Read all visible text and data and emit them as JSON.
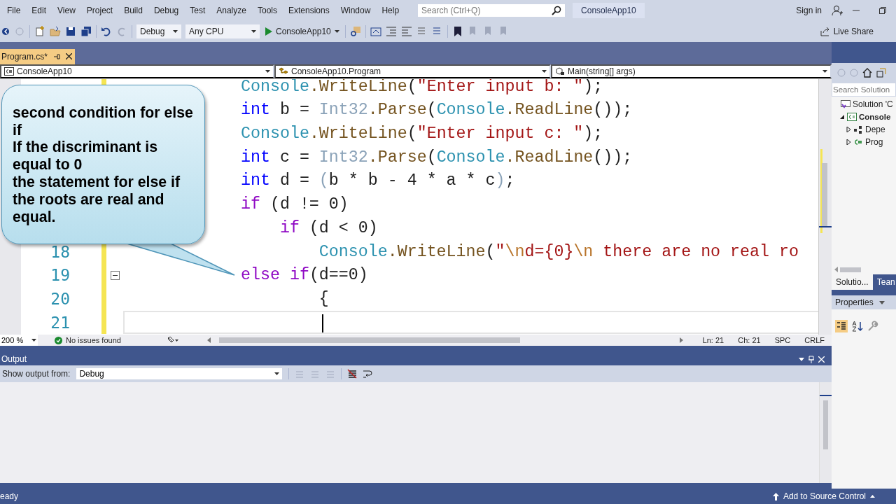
{
  "menu": [
    "File",
    "Edit",
    "View",
    "Project",
    "Build",
    "Debug",
    "Test",
    "Analyze",
    "Tools",
    "Extensions",
    "Window",
    "Help"
  ],
  "search": {
    "placeholder": "Search (Ctrl+Q)"
  },
  "solution_badge": "ConsoleApp10",
  "account": {
    "sign_in": "Sign in"
  },
  "toolbar": {
    "configuration": "Debug",
    "platform": "Any CPU",
    "start": "ConsoleApp10",
    "live_share": "Live Share"
  },
  "document_tabs": [
    {
      "label": "Program.cs*",
      "selected": true
    }
  ],
  "navigation": {
    "project": "ConsoleApp10",
    "type": "ConsoleApp10.Program",
    "member": "Main(string[] args)"
  },
  "editor": {
    "lines": [
      {
        "tokens": [
          {
            "kind": "type",
            "text": "Console"
          },
          {
            "kind": "method",
            "text": ".WriteLine"
          },
          {
            "kind": "plain",
            "text": "("
          },
          {
            "kind": "string",
            "text": "\"Enter input b: \""
          },
          {
            "kind": "plain",
            "text": ");"
          }
        ]
      },
      {
        "tokens": [
          {
            "kind": "keyword",
            "text": "int"
          },
          {
            "kind": "plain",
            "text": " b = "
          },
          {
            "kind": "faded",
            "text": "Int32"
          },
          {
            "kind": "method",
            "text": ".Parse"
          },
          {
            "kind": "plain",
            "text": "("
          },
          {
            "kind": "type",
            "text": "Console"
          },
          {
            "kind": "method",
            "text": ".ReadLine"
          },
          {
            "kind": "plain",
            "text": "());"
          }
        ]
      },
      {
        "tokens": [
          {
            "kind": "type",
            "text": "Console"
          },
          {
            "kind": "method",
            "text": ".WriteLine"
          },
          {
            "kind": "plain",
            "text": "("
          },
          {
            "kind": "string",
            "text": "\"Enter input c: \""
          },
          {
            "kind": "plain",
            "text": ");"
          }
        ]
      },
      {
        "tokens": [
          {
            "kind": "keyword",
            "text": "int"
          },
          {
            "kind": "plain",
            "text": " c = "
          },
          {
            "kind": "faded",
            "text": "Int32"
          },
          {
            "kind": "method",
            "text": ".Parse"
          },
          {
            "kind": "plain",
            "text": "("
          },
          {
            "kind": "type",
            "text": "Console"
          },
          {
            "kind": "method",
            "text": ".ReadLine"
          },
          {
            "kind": "plain",
            "text": "());"
          }
        ]
      },
      {
        "tokens": [
          {
            "kind": "keyword",
            "text": "int"
          },
          {
            "kind": "plain",
            "text": " d = "
          },
          {
            "kind": "faded",
            "text": "("
          },
          {
            "kind": "plain",
            "text": "b * b - 4 * a * c"
          },
          {
            "kind": "faded",
            "text": ")"
          },
          {
            "kind": "plain",
            "text": ";"
          }
        ]
      },
      {
        "tokens": [
          {
            "kind": "control",
            "text": "if"
          },
          {
            "kind": "plain",
            "text": " (d != 0)"
          }
        ]
      },
      {
        "tokens": [
          {
            "kind": "control",
            "text": "    if"
          },
          {
            "kind": "plain",
            "text": " (d < 0)"
          }
        ]
      },
      {
        "number": "18",
        "tokens": [
          {
            "kind": "type",
            "text": "        Console"
          },
          {
            "kind": "method",
            "text": ".WriteLine"
          },
          {
            "kind": "plain",
            "text": "("
          },
          {
            "kind": "string",
            "text": "\""
          },
          {
            "kind": "escape",
            "text": "\\n"
          },
          {
            "kind": "string",
            "text": "d={0}"
          },
          {
            "kind": "escape",
            "text": "\\n"
          },
          {
            "kind": "string",
            "text": " there are no real ro"
          }
        ]
      },
      {
        "number": "19",
        "collapsible": true,
        "tokens": [
          {
            "kind": "control",
            "text": "else if"
          },
          {
            "kind": "plain",
            "text": "(d==0)"
          }
        ]
      },
      {
        "number": "20",
        "tokens": [
          {
            "kind": "plain",
            "text": "        {"
          }
        ]
      },
      {
        "number": "21",
        "current": true
      }
    ],
    "callout": "second condition for else if\nIf the discriminant is equal to 0\nthe statement for else if the roots are real and equal."
  },
  "editor_status": {
    "zoom": "200 %",
    "issues": "No issues found",
    "line": "Ln: 21",
    "column": "Ch: 21",
    "whitespace": "SPC",
    "line_ending": "CRLF"
  },
  "output": {
    "title": "Output",
    "source_label": "Show output from:",
    "source": "Debug"
  },
  "solution_explorer": {
    "search_placeholder": "Search Solution",
    "tree": [
      {
        "label": "Solution 'C",
        "kind": "solution",
        "children": [
          {
            "label": "Console",
            "kind": "project",
            "expanded": true,
            "children": [
              {
                "label": "Depe",
                "kind": "dependencies",
                "expanded": false
              },
              {
                "label": "Prog",
                "kind": "file",
                "expanded": false
              }
            ]
          }
        ]
      }
    ],
    "tabs": [
      {
        "label": "Solutio...",
        "selected": true
      },
      {
        "label": "Tean",
        "selected": false
      }
    ]
  },
  "properties": {
    "title": "Properties"
  },
  "status_bar": {
    "message": "eady",
    "source_control": "Add to Source Control"
  }
}
